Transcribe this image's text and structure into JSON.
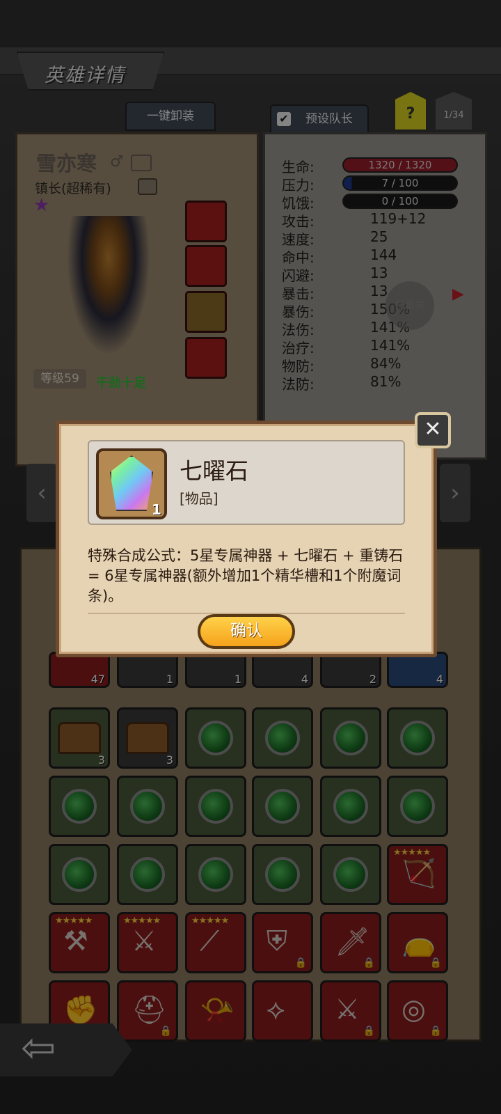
{
  "header": {
    "title": "英雄详情"
  },
  "tabs": {
    "unequip_all": "一键卸装",
    "preset_leader": "预设队长",
    "help": "?",
    "count": "1/34"
  },
  "hero": {
    "name": "雪亦寒",
    "title": "镇长(超稀有)",
    "level": "等级59",
    "mood": "干劲十足"
  },
  "stats": {
    "labels": [
      "生命:",
      "压力:",
      "饥饿:",
      "攻击:",
      "速度:",
      "命中:",
      "闪避:",
      "暴击:",
      "暴伤:",
      "法伤:",
      "治疗:",
      "物防:",
      "法防:"
    ],
    "hp": "1320 / 1320",
    "stress": "7 / 100",
    "hunger": "0 / 100",
    "values": [
      "119+12",
      "25",
      "144",
      "13",
      "13",
      "150%",
      "141%",
      "141%",
      "84%",
      "81%"
    ],
    "hosting": "托管关"
  },
  "dialog": {
    "item_name": "七曜石",
    "item_type": "[物品]",
    "item_count": "1",
    "description": "特殊合成公式：5星专属神器 + 七曜石 + 重铸石 = 6星专属神器(额外增加1个精华槽和1个附魔词条)。",
    "confirm_label": "确认"
  },
  "inventory": {
    "row0_counts": [
      "47",
      "1",
      "1",
      "4",
      "2",
      "4"
    ],
    "chest_counts": [
      "3",
      "3"
    ],
    "star_label": "★★★★★"
  },
  "colors": {
    "dialog_bg": "#e6d3b4",
    "confirm": "#f5b21a",
    "hp_bar": "#9a1e2a",
    "stress_bar": "#1e3a8a"
  }
}
